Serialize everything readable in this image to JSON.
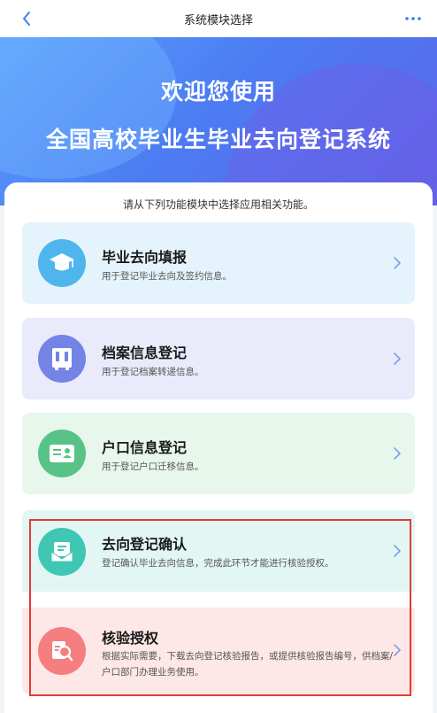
{
  "nav": {
    "title": "系统模块选择",
    "back_icon": "chevron-left-icon",
    "more_icon": "more-dots-icon"
  },
  "hero": {
    "line1": "欢迎您使用",
    "line2": "全国高校毕业生毕业去向登记系统"
  },
  "intro": "请从下列功能模块中选择应用相关功能。",
  "modules": [
    {
      "title": "毕业去向填报",
      "desc": "用于登记毕业去向及签约信息。",
      "icon": "graduation-cap-icon",
      "bg": "#e4f3fc",
      "icon_bg": "#4eb6ec"
    },
    {
      "title": "档案信息登记",
      "desc": "用于登记档案转递信息。",
      "icon": "archive-cabinet-icon",
      "bg": "#e9ebfb",
      "icon_bg": "#7483e6"
    },
    {
      "title": "户口信息登记",
      "desc": "用于登记户口迁移信息。",
      "icon": "id-card-icon",
      "bg": "#e8f7ec",
      "icon_bg": "#58c386"
    },
    {
      "title": "去向登记确认",
      "desc": "登记确认毕业去向信息，完成此环节才能进行核验授权。",
      "icon": "confirm-document-icon",
      "bg": "#e2f6f4",
      "icon_bg": "#3fc7b4"
    },
    {
      "title": "核验授权",
      "desc": "根据实际需要，下载去向登记核验报告，或提供核验报告编号，供档案/户口部门办理业务使用。",
      "icon": "search-document-icon",
      "bg": "#fde7e7",
      "icon_bg": "#f57e7e"
    }
  ],
  "colors": {
    "highlight_border": "#e53935",
    "chevron": "#7ea2e8"
  }
}
